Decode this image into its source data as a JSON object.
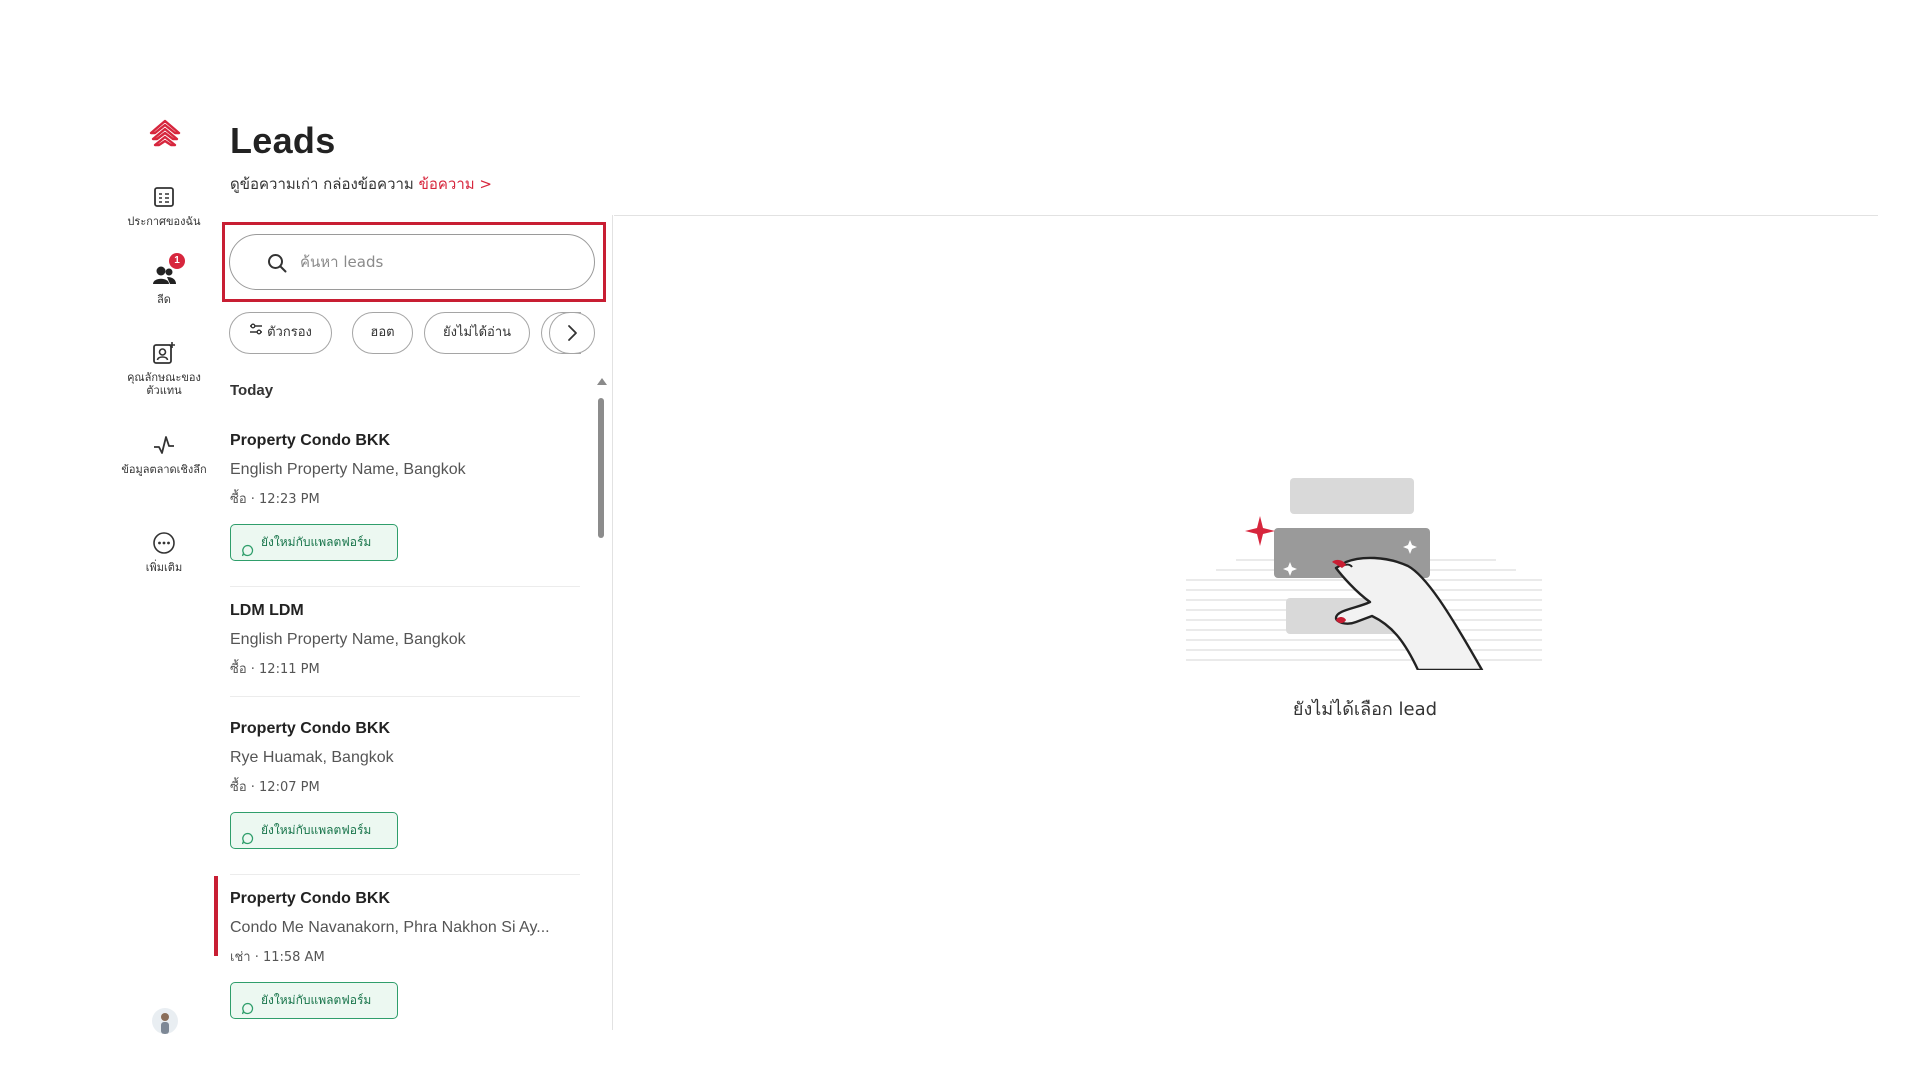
{
  "nav": {
    "items": [
      {
        "label": "ประกาศของฉัน",
        "icon": "listings-icon"
      },
      {
        "label": "ลีด",
        "icon": "people-icon",
        "badge": "1"
      },
      {
        "label": "คุณลักษณะของตัวแทน",
        "icon": "agent-profile-icon"
      },
      {
        "label": "ข้อมูลตลาดเชิงลึก",
        "icon": "analytics-icon"
      },
      {
        "label": "เพิ่มเติม",
        "icon": "more-icon"
      }
    ]
  },
  "header": {
    "title": "Leads",
    "subtitle_text": "ดูข้อความเก่า กล่องข้อความ",
    "subtitle_link": "ข้อความ >"
  },
  "search": {
    "placeholder": "ค้นหา leads",
    "value": ""
  },
  "chips": [
    {
      "label": "ตัวกรอง"
    },
    {
      "label": "ฮอต"
    },
    {
      "label": "ยังไม่ได้อ่าน"
    }
  ],
  "list": {
    "section": "Today",
    "leads": [
      {
        "name": "Property Condo BKK",
        "place": "English Property Name, Bangkok",
        "meta": "ซื้อ · 12:23 PM",
        "tag": "ยังใหม่กับแพลตฟอร์ม"
      },
      {
        "name": "LDM LDM",
        "place": "English Property Name, Bangkok",
        "meta": "ซื้อ · 12:11 PM",
        "tag": ""
      },
      {
        "name": "Property Condo BKK",
        "place": "Rye Huamak, Bangkok",
        "meta": "ซื้อ · 12:07 PM",
        "tag": "ยังใหม่กับแพลตฟอร์ม"
      },
      {
        "name": "Property Condo BKK",
        "place": "Condo Me Navanakorn, Phra Nakhon Si Ay...",
        "meta": "เช่า · 11:58 AM",
        "tag": "ยังใหม่กับแพลตฟอร์ม"
      }
    ]
  },
  "empty_state": {
    "text": "ยังไม่ได้เลือก lead"
  },
  "colors": {
    "accent": "#c81e33",
    "tag_green": "#2f9e6b",
    "tag_bg": "#ecf8f1"
  }
}
